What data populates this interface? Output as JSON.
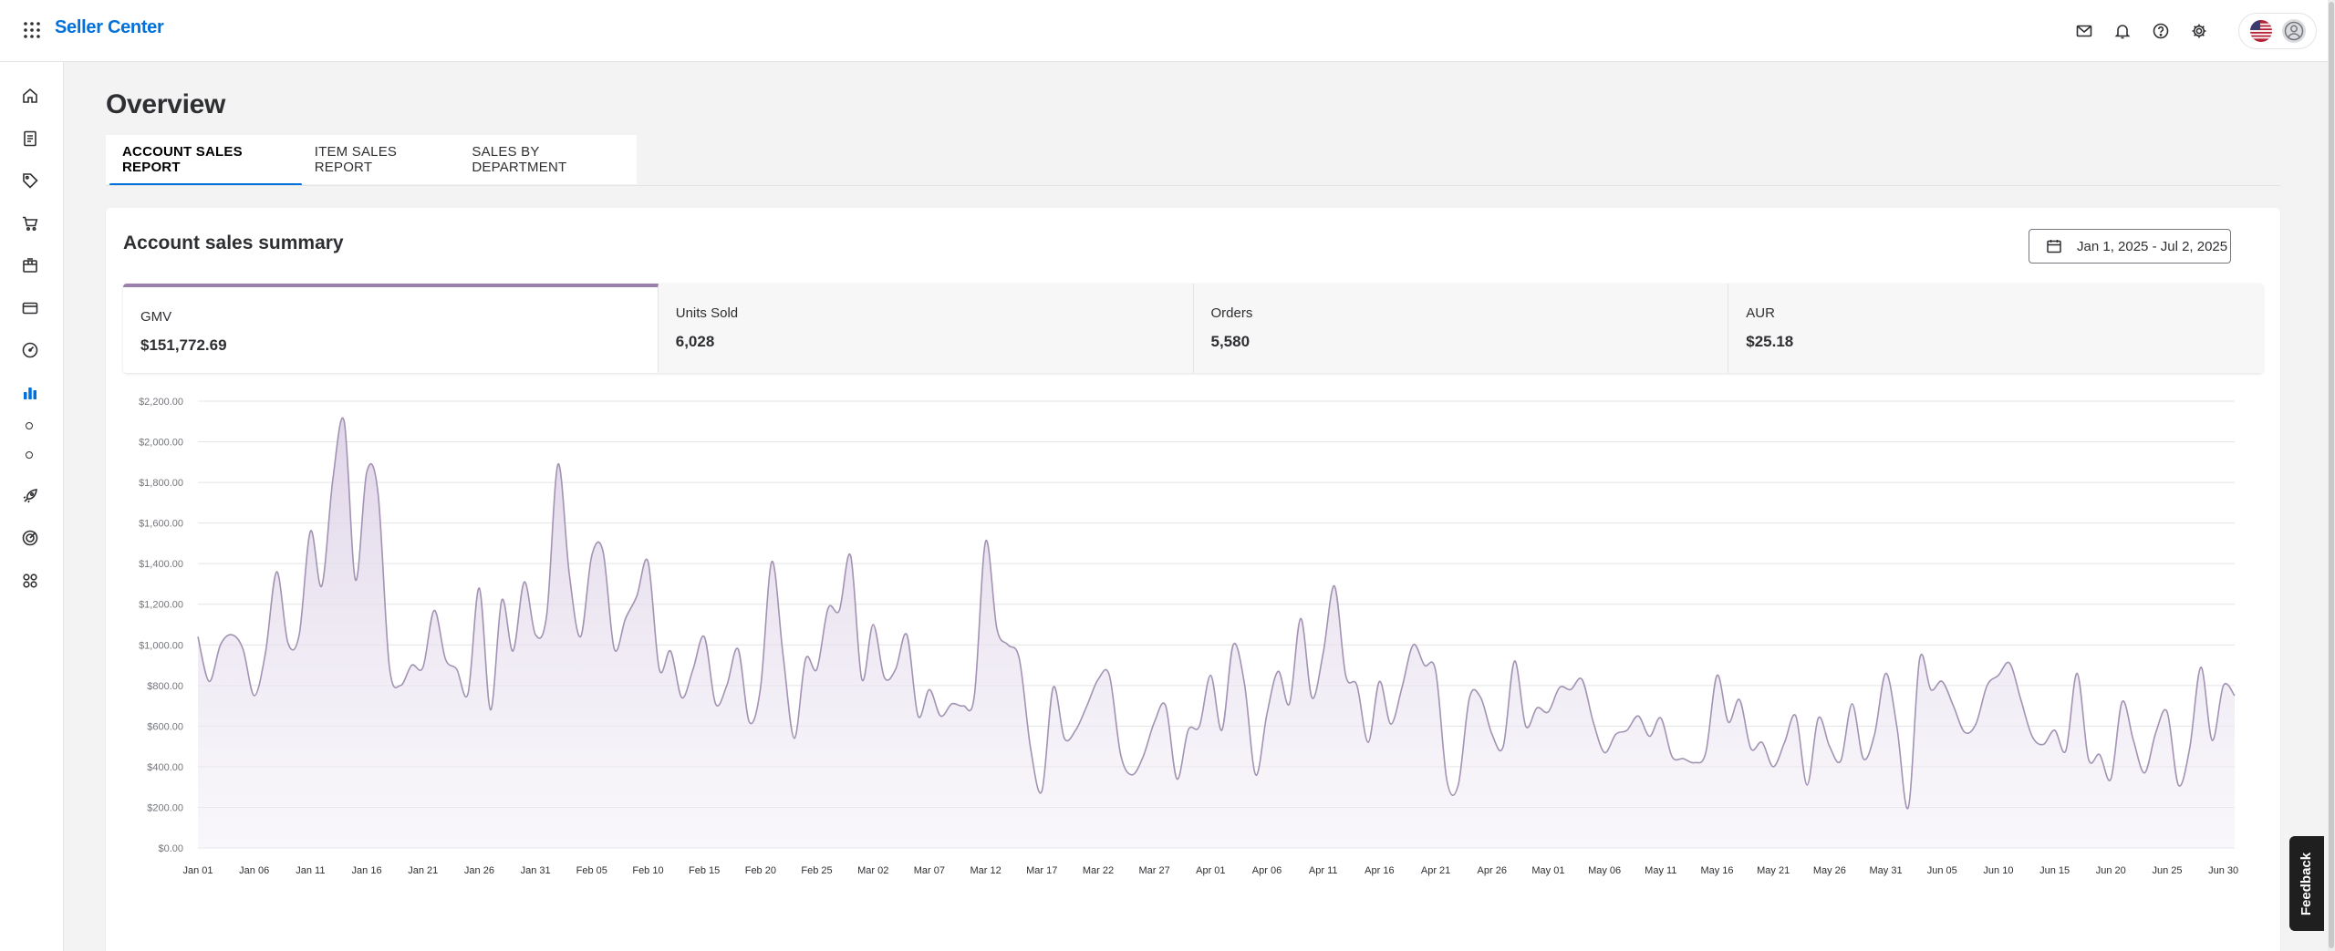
{
  "header": {
    "brand": "Seller Center",
    "icons": [
      "mail-icon",
      "bell-icon",
      "help-icon",
      "gear-icon"
    ]
  },
  "sidebar": {
    "items": [
      "home-icon",
      "document-icon",
      "tag-icon",
      "cart-icon",
      "box-icon",
      "card-icon",
      "gauge-icon",
      "analytics-icon",
      "sub-dot",
      "sub-dot",
      "rocket-icon",
      "target-icon",
      "apps-grid-icon"
    ],
    "active": "analytics-icon"
  },
  "page": {
    "title": "Overview",
    "tabs": [
      {
        "label": "ACCOUNT SALES REPORT",
        "active": true
      },
      {
        "label": "ITEM SALES REPORT",
        "active": false
      },
      {
        "label": "SALES BY DEPARTMENT",
        "active": false
      }
    ]
  },
  "summary": {
    "title": "Account sales summary",
    "date_range": "Jan 1, 2025 - Jul 2, 2025",
    "metrics": [
      {
        "label": "GMV",
        "value": "$151,772.69",
        "selected": true
      },
      {
        "label": "Units Sold",
        "value": "6,028",
        "selected": false
      },
      {
        "label": "Orders",
        "value": "5,580",
        "selected": false
      },
      {
        "label": "AUR",
        "value": "$25.18",
        "selected": false
      }
    ]
  },
  "colors": {
    "brand": "#0071dc",
    "series_line": "#a393b3",
    "series_fill_top": "#dcd1e6",
    "selected_metric_accent": "#9b80ae"
  },
  "feedback_label": "Feedback",
  "chart_data": {
    "type": "area",
    "title": "",
    "xlabel": "",
    "ylabel": "",
    "ylim": [
      0,
      2200
    ],
    "y_ticks": [
      "$0.00",
      "$200.00",
      "$400.00",
      "$600.00",
      "$800.00",
      "$1,000.00",
      "$1,200.00",
      "$1,400.00",
      "$1,600.00",
      "$1,800.00",
      "$2,000.00",
      "$2,200.00"
    ],
    "x_ticks": [
      "Jan 01",
      "Jan 06",
      "Jan 11",
      "Jan 16",
      "Jan 21",
      "Jan 26",
      "Jan 31",
      "Feb 05",
      "Feb 10",
      "Feb 15",
      "Feb 20",
      "Feb 25",
      "Mar 02",
      "Mar 07",
      "Mar 12",
      "Mar 17",
      "Mar 22",
      "Mar 27",
      "Apr 01",
      "Apr 06",
      "Apr 11",
      "Apr 16",
      "Apr 21",
      "Apr 26",
      "May 01",
      "May 06",
      "May 11",
      "May 16",
      "May 21",
      "May 26",
      "May 31",
      "Jun 05",
      "Jun 10",
      "Jun 15",
      "Jun 20",
      "Jun 25",
      "Jun 30"
    ],
    "x_start": "2025-01-01",
    "x_end": "2025-07-02",
    "grid": true,
    "legend": "none",
    "series": [
      {
        "values": [
          1040,
          820,
          1000,
          1050,
          980,
          750,
          960,
          1360,
          1010,
          1050,
          1560,
          1290,
          1820,
          2100,
          1320,
          1850,
          1750,
          900,
          800,
          900,
          890,
          1170,
          930,
          880,
          760,
          1280,
          680,
          1220,
          970,
          1310,
          1050,
          1150,
          1890,
          1350,
          1040,
          1440,
          1460,
          980,
          1130,
          1240,
          1410,
          880,
          970,
          740,
          880,
          1040,
          710,
          800,
          980,
          620,
          790,
          1410,
          950,
          540,
          930,
          880,
          1180,
          1170,
          1440,
          830,
          1100,
          840,
          880,
          1050,
          650,
          780,
          650,
          710,
          700,
          750,
          1510,
          1080,
          1000,
          930,
          490,
          280,
          790,
          540,
          580,
          700,
          830,
          850,
          460,
          360,
          450,
          620,
          700,
          340,
          580,
          600,
          850,
          580,
          1000,
          810,
          360,
          660,
          870,
          710,
          1130,
          740,
          960,
          1290,
          850,
          800,
          520,
          820,
          610,
          790,
          1000,
          900,
          870,
          330,
          310,
          740,
          740,
          560,
          500,
          920,
          600,
          690,
          670,
          790,
          780,
          830,
          620,
          470,
          560,
          580,
          650,
          550,
          640,
          450,
          440,
          420,
          470,
          850,
          620,
          730,
          490,
          520,
          400,
          520,
          650,
          310,
          640,
          500,
          430,
          710,
          440,
          560,
          860,
          590,
          200,
          930,
          780,
          820,
          700,
          570,
          610,
          800,
          850,
          910,
          730,
          550,
          510,
          580,
          480,
          860,
          440,
          460,
          340,
          720,
          530,
          370,
          570,
          670,
          310,
          490,
          890,
          530,
          800,
          750
        ]
      }
    ]
  }
}
